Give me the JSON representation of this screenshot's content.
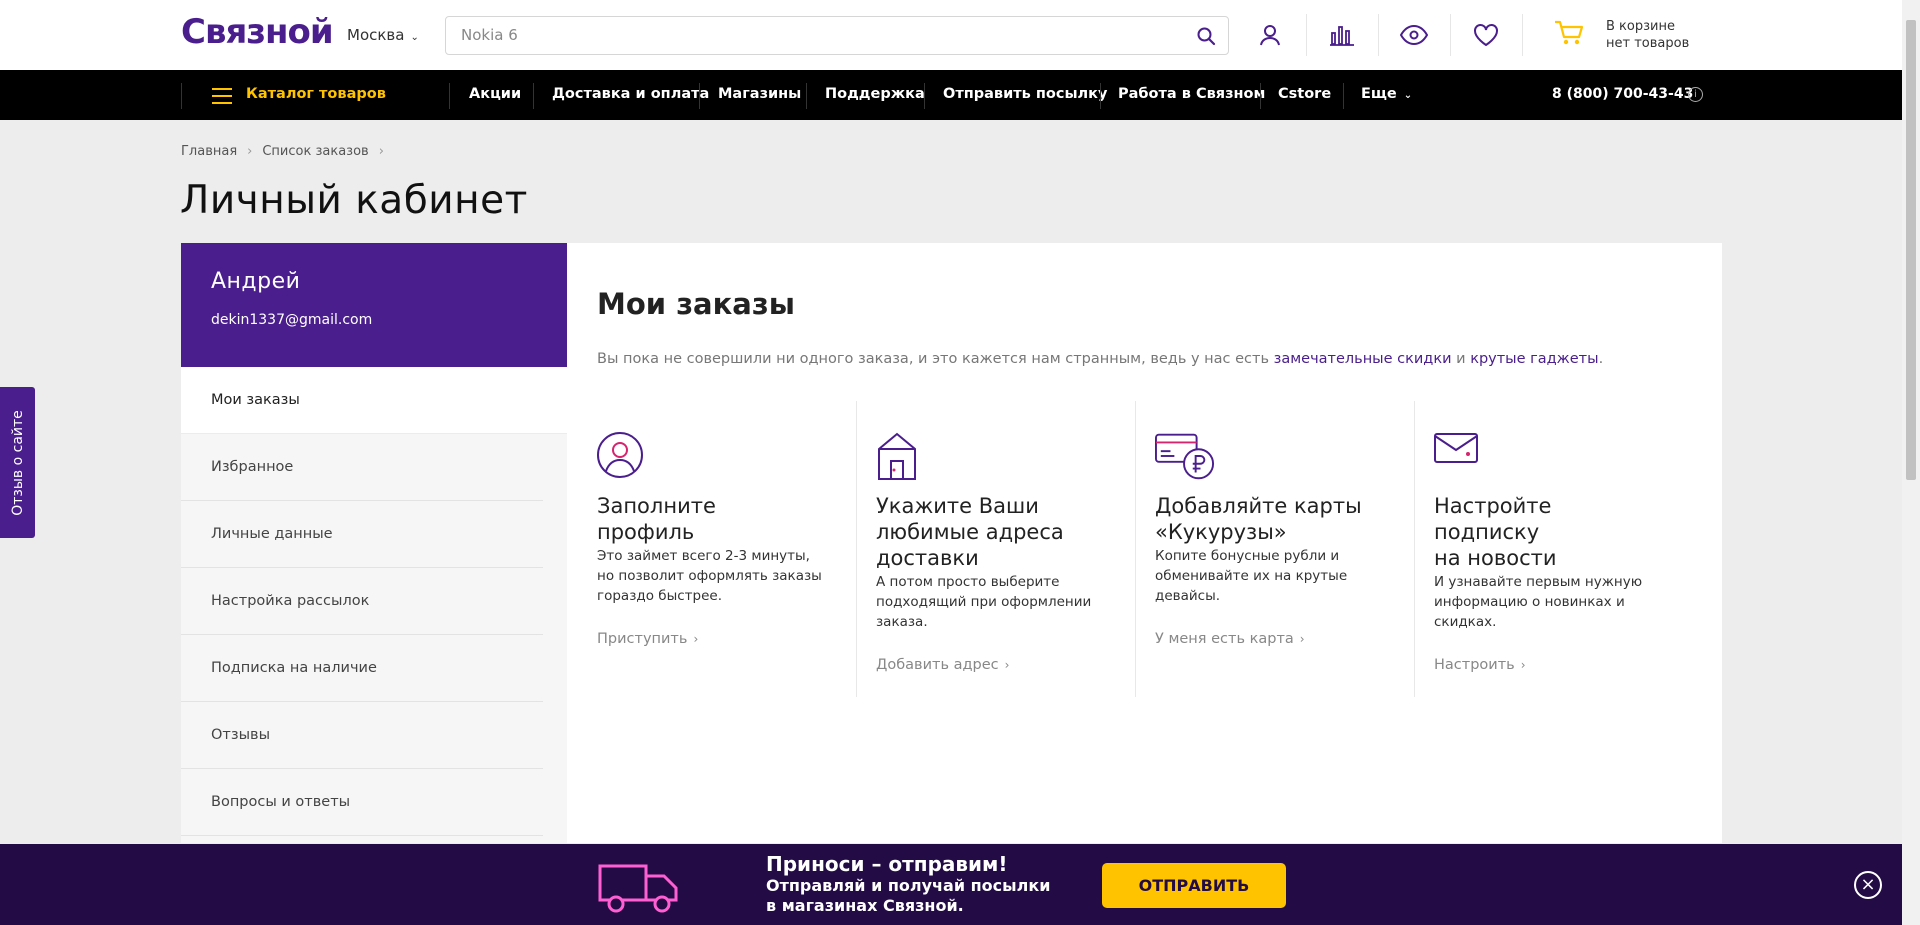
{
  "header": {
    "logo": "Связной",
    "city": "Москва",
    "search_placeholder": "Nokia 6",
    "cart_line1": "В корзине",
    "cart_line2": "нет товаров"
  },
  "nav": {
    "catalog": "Каталог товаров",
    "items": [
      "Акции",
      "Доставка и оплата",
      "Магазины",
      "Поддержка",
      "Отправить посылку",
      "Работа в Связном",
      "Cstore",
      "Еще"
    ],
    "phone": "8 (800) 700-43-43"
  },
  "breadcrumbs": [
    "Главная",
    "Список заказов"
  ],
  "page_title": "Личный кабинет",
  "user": {
    "name": "Андрей",
    "email": "dekin1337@gmail.com"
  },
  "sidebar": {
    "items": [
      "Мои заказы",
      "Избранное",
      "Личные данные",
      "Настройка рассылок",
      "Подписка на наличие",
      "Отзывы",
      "Вопросы и ответы"
    ]
  },
  "main": {
    "title": "Мои заказы",
    "desc_prefix": "Вы пока не совершили ни одного заказа, и это кажется нам странным, ведь у нас есть ",
    "desc_link1": "замечательные скидки",
    "desc_mid": " и ",
    "desc_link2": "крутые гаджеты",
    "desc_suffix": ".",
    "cards": [
      {
        "title": "Заполните профиль",
        "text": "Это займет всего 2-3 минуты, но позволит оформлять заказы гораздо быстрее.",
        "link": "Приступить"
      },
      {
        "title": "Укажите Ваши любимые адреса доставки",
        "text": "А потом просто выберите подходящий при оформлении заказа.",
        "link": "Добавить адрес"
      },
      {
        "title": "Добавляйте карты «Кукурузы»",
        "text": "Копите бонусные рубли и обменивайте их на крутые девайсы.",
        "link": "У меня есть карта"
      },
      {
        "title": "Настройте подписку на новости",
        "text": "И узнавайте первым нужную информацию о новинках и скидках.",
        "link": "Настроить"
      }
    ]
  },
  "feedback_tab": "Отзыв о сайте",
  "promo": {
    "heading": "Приноси – отправим!",
    "line1": "Отправляй и получай посылки",
    "line2": "в магазинах Связной.",
    "button": "ОТПРАВИТЬ"
  },
  "colors": {
    "brand_purple": "#4a1e8c",
    "accent_yellow": "#ffc300",
    "promo_bg": "#230c46"
  }
}
